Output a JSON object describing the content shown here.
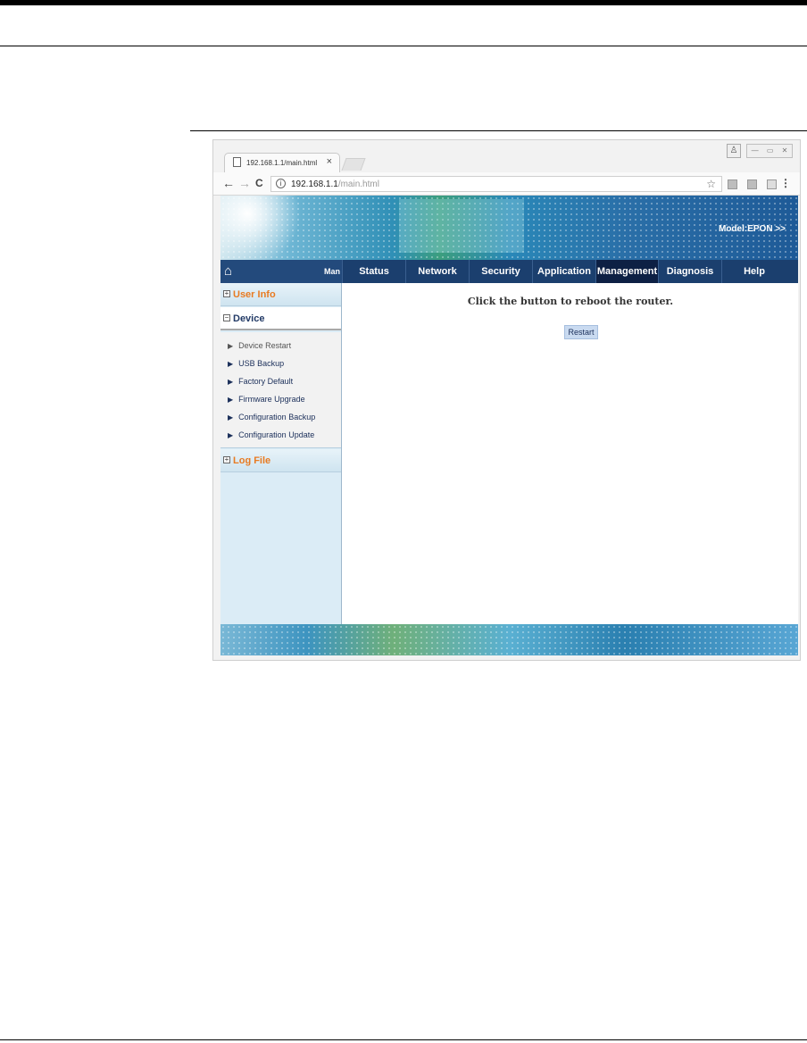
{
  "browser": {
    "tab_title": "192.168.1.1/main.html",
    "tab_close": "×",
    "url_host": "192.168.1.1",
    "url_path": "/main.html",
    "nav": {
      "back": "←",
      "forward": "→",
      "reload": "C"
    }
  },
  "banner": {
    "model_text": "Model:EPON  >>"
  },
  "navbar": {
    "home_label": "Man",
    "items": [
      "Status",
      "Network",
      "Security",
      "Application",
      "Management",
      "Diagnosis",
      "Help"
    ],
    "active": "Management"
  },
  "sidebar": {
    "groups": [
      {
        "label": "User Info",
        "sign": "+"
      },
      {
        "label": "Device",
        "sign": "−"
      },
      {
        "label": "Log File",
        "sign": "+"
      }
    ],
    "device_items": [
      "Device Restart",
      "USB Backup",
      "Factory Default",
      "Firmware Upgrade",
      "Configuration Backup",
      "Configuration Update"
    ],
    "current_item": "Device Restart"
  },
  "content": {
    "message": "Click the button to reboot the router.",
    "restart_label": "Restart"
  },
  "colors": {
    "nav_bg": "#1b3f6e",
    "nav_active": "#0d2044",
    "group_accent": "#e87b22",
    "sidebar_bg": "#dbecf6"
  }
}
